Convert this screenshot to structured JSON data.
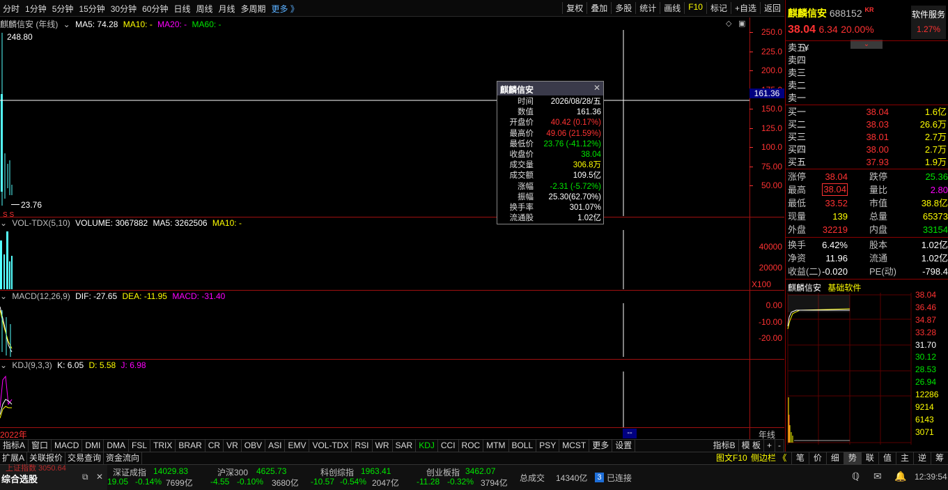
{
  "toolbar": {
    "periods": [
      "分时",
      "1分钟",
      "5分钟",
      "15分钟",
      "30分钟",
      "60分钟",
      "日线",
      "周线",
      "月线",
      "多周期",
      "更多 》"
    ],
    "tools": [
      "复权",
      "叠加",
      "多股",
      "统计",
      "画线",
      "F10",
      "标记",
      "+自选",
      "返回"
    ]
  },
  "kline": {
    "title": "麒麟信安 (年线)",
    "ma5": "MA5: 74.28",
    "ma10": "MA10: -",
    "ma20": "MA20: -",
    "ma60": "MA60: -",
    "high_label": "248.80",
    "low_label": "23.76",
    "cursor_value": "161.36",
    "axis": [
      "250.0",
      "225.0",
      "200.0",
      "175.0",
      "150.0",
      "125.0",
      "100.0",
      "75.00",
      "50.00"
    ]
  },
  "volume": {
    "title": "VOL-TDX(5,10)",
    "vol": "VOLUME: 3067882",
    "ma5": "MA5: 3262506",
    "ma10": "MA10: -",
    "axis": [
      "40000",
      "20000"
    ],
    "unit": "X100"
  },
  "macd": {
    "title": "MACD(12,26,9)",
    "dif": "DIF: -27.65",
    "dea": "DEA: -11.95",
    "macd": "MACD: -31.40",
    "axis": [
      "0.00",
      "-10.00",
      "-20.00"
    ]
  },
  "kdj": {
    "title": "KDJ(9,3,3)",
    "k": "K: 6.05",
    "d": "D: 5.58",
    "j": "J: 6.98"
  },
  "xaxis": {
    "year": "2022年",
    "cursor": "--",
    "period": "年线"
  },
  "tooltip": {
    "title": "麒麟信安",
    "rows": [
      {
        "k": "时间",
        "v": "2026/08/28/五",
        "c": "white"
      },
      {
        "k": "数值",
        "v": "161.36",
        "c": "white"
      },
      {
        "k": "开盘价",
        "v": "40.42 (0.17%)",
        "c": "red"
      },
      {
        "k": "最高价",
        "v": "49.06 (21.59%)",
        "c": "red"
      },
      {
        "k": "最低价",
        "v": "23.76 (-41.12%)",
        "c": "green"
      },
      {
        "k": "收盘价",
        "v": "38.04",
        "c": "green"
      },
      {
        "k": "成交量",
        "v": "306.8万",
        "c": "yellow"
      },
      {
        "k": "成交额",
        "v": "109.5亿",
        "c": "white"
      },
      {
        "k": "涨幅",
        "v": "-2.31 (-5.72%)",
        "c": "green"
      },
      {
        "k": "振幅",
        "v": "25.30(62.70%)",
        "c": "white"
      },
      {
        "k": "换手率",
        "v": "301.07%",
        "c": "white"
      },
      {
        "k": "流通股",
        "v": "1.02亿",
        "c": "white"
      }
    ]
  },
  "stock": {
    "name": "麒麟信安",
    "code": "688152",
    "tag": "KR",
    "price": "38.04",
    "change": "6.34",
    "pct": "20.00%",
    "service": "软件服务",
    "service_pct": "1.27%"
  },
  "sells": [
    {
      "k": "卖五",
      "p": "¥",
      "v": ""
    },
    {
      "k": "卖四",
      "p": "",
      "v": ""
    },
    {
      "k": "卖三",
      "p": "",
      "v": ""
    },
    {
      "k": "卖二",
      "p": "",
      "v": ""
    },
    {
      "k": "卖一",
      "p": "",
      "v": ""
    }
  ],
  "buys": [
    {
      "k": "买一",
      "p": "38.04",
      "v": "1.6亿"
    },
    {
      "k": "买二",
      "p": "38.03",
      "v": "26.6万"
    },
    {
      "k": "买三",
      "p": "38.01",
      "v": "2.7万"
    },
    {
      "k": "买四",
      "p": "38.00",
      "v": "2.7万"
    },
    {
      "k": "买五",
      "p": "37.93",
      "v": "1.9万"
    }
  ],
  "quote": {
    "zt_k": "涨停",
    "zt_v": "38.04",
    "dt_k": "跌停",
    "dt_v": "25.36",
    "zg_k": "最高",
    "zg_v": "38.04",
    "lb_k": "量比",
    "lb_v": "2.80",
    "zd_k": "最低",
    "zd_v": "33.52",
    "sz_k": "市值",
    "sz_v": "38.8亿",
    "xl_k": "现量",
    "xl_v": "139",
    "zl_k": "总量",
    "zl_v": "65373",
    "wp_k": "外盘",
    "wp_v": "32219",
    "np_k": "内盘",
    "np_v": "33154",
    "hs_k": "换手",
    "hs_v": "6.42%",
    "gb_k": "股本",
    "gb_v": "1.02亿",
    "jz_k": "净资",
    "jz_v": "11.96",
    "lt_k": "流通",
    "lt_v": "1.02亿",
    "sy_k": "收益(二)",
    "sy_v": "-0.020",
    "pe_k": "PE(动)",
    "pe_v": "-798.4"
  },
  "mini": {
    "name": "麒麟信安",
    "sector": "基础软件",
    "axis_top": [
      "38.04",
      "36.46",
      "34.87",
      "33.28"
    ],
    "axis_mid": "31.70",
    "axis_bot": [
      "30.12",
      "28.53",
      "26.94"
    ],
    "vol_axis": [
      "12286",
      "9214",
      "6143",
      "3071"
    ]
  },
  "indicators": [
    "指标A",
    "窗口",
    "MACD",
    "DMI",
    "DMA",
    "FSL",
    "TRIX",
    "BRAR",
    "CR",
    "VR",
    "OBV",
    "ASI",
    "EMV",
    "VOL-TDX",
    "RSI",
    "WR",
    "SAR",
    "KDJ",
    "CCI",
    "ROC",
    "MTM",
    "BOLL",
    "PSY",
    "MCST",
    "更多",
    "设置"
  ],
  "indicator_right": [
    "指标B",
    "模 板",
    "+",
    "-"
  ],
  "subtabs": [
    "扩展A",
    "关联报价",
    "交易查询",
    "资金流向"
  ],
  "subtabs_right_label": "图文F10",
  "subtabs_right_label2": "侧边栏 《",
  "right_tabs": [
    "笔",
    "价",
    "细",
    "势",
    "联",
    "值",
    "主",
    "逆",
    "筹"
  ],
  "status": {
    "panel": "综合选股",
    "index_top_clip": "上证指数 3050.64",
    "sh_change": "19.05",
    "sh_pct": "-0.14%",
    "sh_amt": "7699亿",
    "sz_name": "深证成指",
    "sz_val": "14029.83",
    "sz_chg": "-4.55",
    "sz_pct": "-0.10%",
    "sz_amt": "3680亿",
    "hs_name": "沪深300",
    "hs_val": "4625.73",
    "hs_chg": "-10.57",
    "hs_pct": "-0.54%",
    "hs_amt": "2047亿",
    "kc_name": "科创综指",
    "kc_val": "1963.41",
    "kc_chg": "-11.28",
    "kc_pct": "-0.32%",
    "kc_amt": "3794亿",
    "cy_name": "创业板指",
    "cy_val": "3462.07",
    "total_k": "总成交",
    "total_v": "14340亿",
    "conn_count": "3",
    "conn_text": "已连接",
    "time": "12:39:54"
  }
}
